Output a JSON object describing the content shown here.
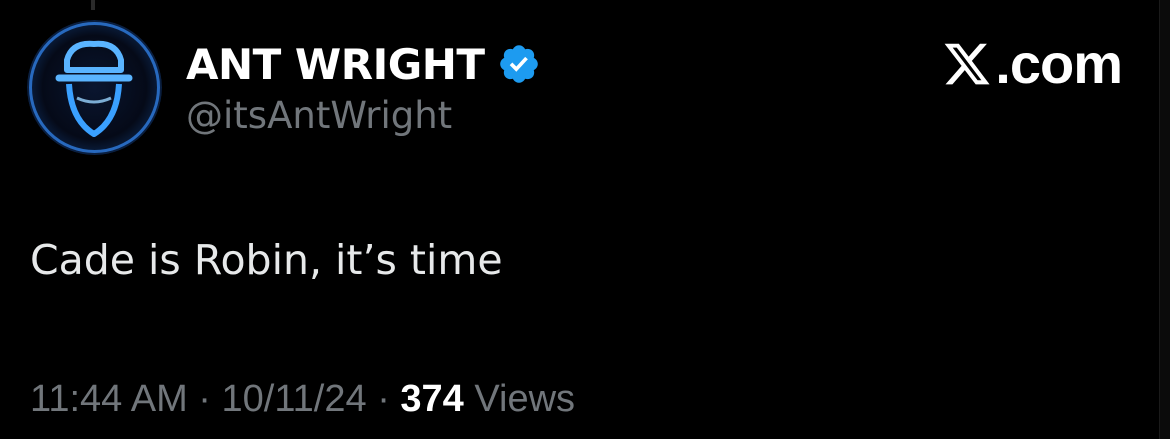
{
  "author": {
    "display_name": "ANT WRIGHT",
    "handle": "@itsAntWright",
    "verified": true,
    "verified_icon": "verified-badge-icon",
    "avatar_icon": "hooded-figure-avatar"
  },
  "brand": {
    "logo_icon": "x-logo-icon",
    "suffix": ".com"
  },
  "tweet": {
    "text": "Cade is Robin, it’s time"
  },
  "meta": {
    "time": "11:44 AM",
    "separator": "·",
    "date": "10/11/24",
    "views_count": "374",
    "views_label": "Views"
  },
  "colors": {
    "background": "#000000",
    "primary_text": "#e7e9ea",
    "secondary_text": "#71767b",
    "verified_blue": "#1d9bf0",
    "avatar_glow": "#3aa0ff"
  }
}
